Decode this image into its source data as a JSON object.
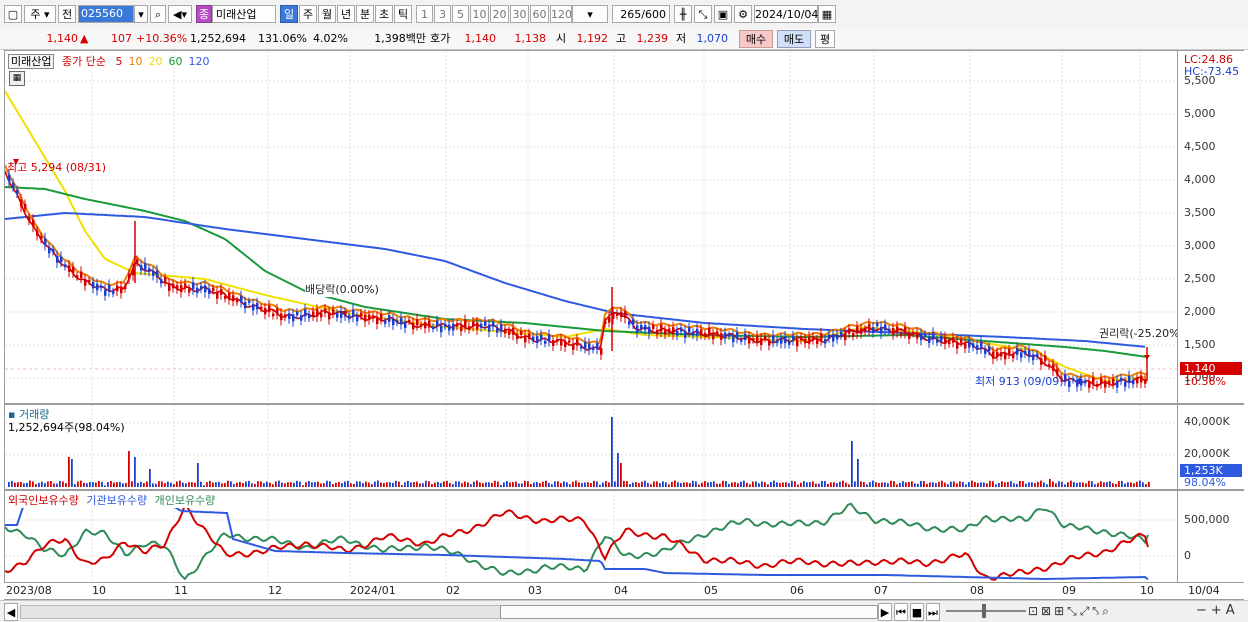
{
  "toolbar": {
    "period_label": "주",
    "prev_label": "전",
    "code_value": "025560",
    "stock_badge": "종",
    "stock_name": "미래산업",
    "period_tabs": [
      "일",
      "주",
      "월",
      "년",
      "분",
      "초",
      "틱"
    ],
    "active_period": "일",
    "interval_buttons": [
      "1",
      "3",
      "5",
      "10",
      "20",
      "30",
      "60",
      "120"
    ],
    "count_value": "265",
    "count_total": "/600",
    "date_value": "2024/10/04"
  },
  "quote": {
    "price": "1,140",
    "change": "107",
    "change_pct": "+10.36%",
    "volume": "1,252,694",
    "volume_ratio": "131.06%",
    "turnover": "4.02%",
    "trade_amount": "1,398백만",
    "ask_label": "호가",
    "ask": "1,140",
    "bid": "1,138",
    "open_label": "시",
    "open": "1,192",
    "high_label": "고",
    "high": "1,239",
    "low_label": "저",
    "low": "1,070",
    "buy_label": "매수",
    "sell_label": "매도",
    "eval_label": "평"
  },
  "price_pane": {
    "legend_name": "미래산업",
    "legend_series": "종가 단순",
    "ma_labels": [
      "5",
      "10",
      "20",
      "60",
      "120"
    ],
    "lc_label": "LC:24.86",
    "hc_label": "HC:-73.45",
    "y_ticks": [
      "5,500",
      "5,000",
      "4,500",
      "4,000",
      "3,500",
      "3,000",
      "2,500",
      "2,000",
      "1,500",
      "1,000"
    ],
    "current_price_tag": "1,140",
    "current_pct_tag": "10.36%",
    "annotations": {
      "high_marker": "최고 5,294 (08/31)",
      "dividend_top": "배당락(0.00%)",
      "dividend_mid": "배당락(0.00%)",
      "rights": "권리락(-25.20%)",
      "low_marker": "최저 913 (09/09)"
    }
  },
  "volume_pane": {
    "title": "거래량",
    "value": "1,252,694주(98.04%)",
    "y_ticks": [
      "40,000K",
      "20,000K"
    ],
    "current_tag": "1,253K",
    "current_pct": "98.04%"
  },
  "holding_pane": {
    "legend": [
      "외국인보유수량",
      "기관보유수량",
      "개인보유수량"
    ],
    "y_ticks": [
      "500,000",
      "0"
    ]
  },
  "x_axis": [
    "2023/08",
    "10",
    "11",
    "12",
    "2024/01",
    "02",
    "03",
    "04",
    "05",
    "06",
    "07",
    "08",
    "09",
    "10",
    "10/04"
  ],
  "colors": {
    "up": "#d40000",
    "down": "#1a3fd0",
    "ma5": "#d40000",
    "ma10": "#f08000",
    "ma20": "#f0e000",
    "ma60": "#1a9a3a",
    "ma120": "#2e5ae0",
    "foreign": "#d40000",
    "institution": "#2e5ae0",
    "individual": "#2e8b57"
  }
}
